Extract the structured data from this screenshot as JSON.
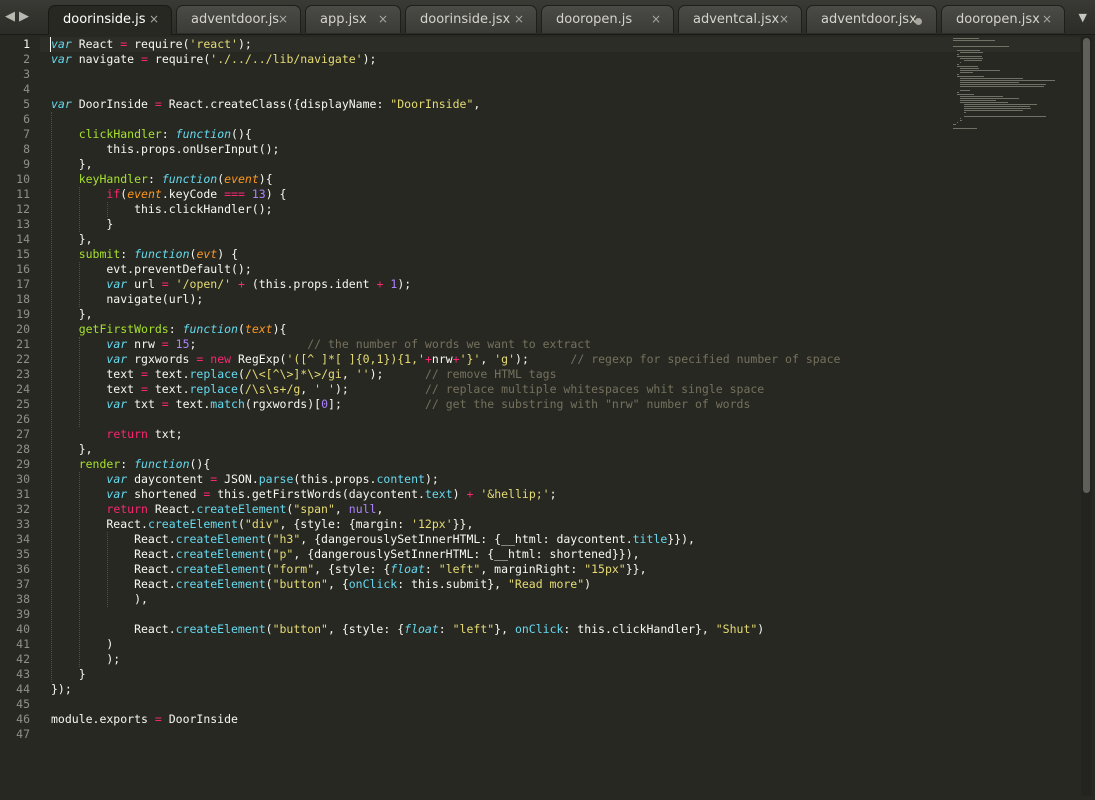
{
  "tabs": [
    {
      "label": "doorinside.js",
      "active": true,
      "dirty": false
    },
    {
      "label": "adventdoor.js",
      "active": false,
      "dirty": false
    },
    {
      "label": "app.jsx",
      "active": false,
      "dirty": false
    },
    {
      "label": "doorinside.jsx",
      "active": false,
      "dirty": false
    },
    {
      "label": "dooropen.js",
      "active": false,
      "dirty": false
    },
    {
      "label": "adventcal.jsx",
      "active": false,
      "dirty": false
    },
    {
      "label": "adventdoor.jsx",
      "active": false,
      "dirty": true
    },
    {
      "label": "dooropen.jsx",
      "active": false,
      "dirty": false
    }
  ],
  "tab_close_glyph": "×",
  "nav": {
    "prev_glyph": "◀",
    "next_glyph": "▶",
    "dropdown_glyph": "▼"
  },
  "editor": {
    "active_line": 1,
    "lines": [
      [
        [
          "k",
          "var"
        ],
        [
          "t",
          " React "
        ],
        [
          "kw",
          "="
        ],
        [
          "t",
          " require("
        ],
        [
          "s",
          "'react'"
        ],
        [
          "t",
          ");"
        ]
      ],
      [
        [
          "k",
          "var"
        ],
        [
          "t",
          " navigate "
        ],
        [
          "kw",
          "="
        ],
        [
          "t",
          " require("
        ],
        [
          "s",
          "'./../../lib/navigate'"
        ],
        [
          "t",
          ");"
        ]
      ],
      [],
      [],
      [
        [
          "k",
          "var"
        ],
        [
          "t",
          " DoorInside "
        ],
        [
          "kw",
          "="
        ],
        [
          "t",
          " React.createClass({displayName: "
        ],
        [
          "s",
          "\"DoorInside\""
        ],
        [
          "t",
          ","
        ]
      ],
      [],
      [
        [
          "t",
          "    "
        ],
        [
          "f",
          "clickHandler"
        ],
        [
          "t",
          ": "
        ],
        [
          "k",
          "function"
        ],
        [
          "t",
          "(){"
        ]
      ],
      [
        [
          "t",
          "        this.props.onUserInput();"
        ]
      ],
      [
        [
          "t",
          "    },"
        ]
      ],
      [
        [
          "t",
          "    "
        ],
        [
          "f",
          "keyHandler"
        ],
        [
          "t",
          ": "
        ],
        [
          "k",
          "function"
        ],
        [
          "t",
          "("
        ],
        [
          "p",
          "event"
        ],
        [
          "t",
          "){"
        ]
      ],
      [
        [
          "t",
          "        "
        ],
        [
          "kw",
          "if"
        ],
        [
          "t",
          "("
        ],
        [
          "p",
          "event"
        ],
        [
          "t",
          ".keyCode "
        ],
        [
          "kw",
          "==="
        ],
        [
          "t",
          " "
        ],
        [
          "n",
          "13"
        ],
        [
          "t",
          ") {"
        ]
      ],
      [
        [
          "t",
          "            this.clickHandler();"
        ]
      ],
      [
        [
          "t",
          "        }"
        ]
      ],
      [
        [
          "t",
          "    },"
        ]
      ],
      [
        [
          "t",
          "    "
        ],
        [
          "f",
          "submit"
        ],
        [
          "t",
          ": "
        ],
        [
          "k",
          "function"
        ],
        [
          "t",
          "("
        ],
        [
          "p",
          "evt"
        ],
        [
          "t",
          ") {"
        ]
      ],
      [
        [
          "t",
          "        evt.preventDefault();"
        ]
      ],
      [
        [
          "t",
          "        "
        ],
        [
          "k",
          "var"
        ],
        [
          "t",
          " url "
        ],
        [
          "kw",
          "="
        ],
        [
          "t",
          " "
        ],
        [
          "s",
          "'/open/'"
        ],
        [
          "t",
          " "
        ],
        [
          "kw",
          "+"
        ],
        [
          "t",
          " (this.props.ident "
        ],
        [
          "kw",
          "+"
        ],
        [
          "t",
          " "
        ],
        [
          "n",
          "1"
        ],
        [
          "t",
          ");"
        ]
      ],
      [
        [
          "t",
          "        navigate(url);"
        ]
      ],
      [
        [
          "t",
          "    },"
        ]
      ],
      [
        [
          "t",
          "    "
        ],
        [
          "f",
          "getFirstWords"
        ],
        [
          "t",
          ": "
        ],
        [
          "k",
          "function"
        ],
        [
          "t",
          "("
        ],
        [
          "p",
          "text"
        ],
        [
          "t",
          "){"
        ]
      ],
      [
        [
          "t",
          "        "
        ],
        [
          "k",
          "var"
        ],
        [
          "t",
          " nrw "
        ],
        [
          "kw",
          "="
        ],
        [
          "t",
          " "
        ],
        [
          "n",
          "15"
        ],
        [
          "t",
          ";                "
        ],
        [
          "c",
          "// the number of words we want to extract"
        ]
      ],
      [
        [
          "t",
          "        "
        ],
        [
          "k",
          "var"
        ],
        [
          "t",
          " rgxwords "
        ],
        [
          "kw",
          "="
        ],
        [
          "t",
          " "
        ],
        [
          "kw",
          "new"
        ],
        [
          "t",
          " RegExp("
        ],
        [
          "s",
          "'([^ ]*[ ]{0,1}){1,'"
        ],
        [
          "kw",
          "+"
        ],
        [
          "t",
          "nrw"
        ],
        [
          "kw",
          "+"
        ],
        [
          "s",
          "'}'"
        ],
        [
          "t",
          ", "
        ],
        [
          "s",
          "'g'"
        ],
        [
          "t",
          ");      "
        ],
        [
          "c",
          "// regexp for specified number of space"
        ]
      ],
      [
        [
          "t",
          "        text "
        ],
        [
          "kw",
          "="
        ],
        [
          "t",
          " text."
        ],
        [
          "sp",
          "replace"
        ],
        [
          "t",
          "("
        ],
        [
          "s",
          "/\\<[^\\>]*\\>/gi"
        ],
        [
          "t",
          ", "
        ],
        [
          "s",
          "''"
        ],
        [
          "t",
          ");      "
        ],
        [
          "c",
          "// remove HTML tags"
        ]
      ],
      [
        [
          "t",
          "        text "
        ],
        [
          "kw",
          "="
        ],
        [
          "t",
          " text."
        ],
        [
          "sp",
          "replace"
        ],
        [
          "t",
          "("
        ],
        [
          "s",
          "/\\s\\s+/g"
        ],
        [
          "t",
          ", "
        ],
        [
          "s",
          "' '"
        ],
        [
          "t",
          ");           "
        ],
        [
          "c",
          "// replace multiple whitespaces whit single space"
        ]
      ],
      [
        [
          "t",
          "        "
        ],
        [
          "k",
          "var"
        ],
        [
          "t",
          " txt "
        ],
        [
          "kw",
          "="
        ],
        [
          "t",
          " text."
        ],
        [
          "sp",
          "match"
        ],
        [
          "t",
          "(rgxwords)["
        ],
        [
          "n",
          "0"
        ],
        [
          "t",
          "];            "
        ],
        [
          "c",
          "// get the substring with \"nrw\" number of words"
        ]
      ],
      [],
      [
        [
          "t",
          "        "
        ],
        [
          "kw",
          "return"
        ],
        [
          "t",
          " txt;"
        ]
      ],
      [
        [
          "t",
          "    },"
        ]
      ],
      [
        [
          "t",
          "    "
        ],
        [
          "f",
          "render"
        ],
        [
          "t",
          ": "
        ],
        [
          "k",
          "function"
        ],
        [
          "t",
          "(){"
        ]
      ],
      [
        [
          "t",
          "        "
        ],
        [
          "k",
          "var"
        ],
        [
          "t",
          " daycontent "
        ],
        [
          "kw",
          "="
        ],
        [
          "t",
          " JSON."
        ],
        [
          "sp",
          "parse"
        ],
        [
          "t",
          "(this.props."
        ],
        [
          "sp",
          "content"
        ],
        [
          "t",
          ");"
        ]
      ],
      [
        [
          "t",
          "        "
        ],
        [
          "k",
          "var"
        ],
        [
          "t",
          " shortened "
        ],
        [
          "kw",
          "="
        ],
        [
          "t",
          " this.getFirstWords(daycontent."
        ],
        [
          "sp",
          "text"
        ],
        [
          "t",
          ") "
        ],
        [
          "kw",
          "+"
        ],
        [
          "t",
          " "
        ],
        [
          "s",
          "'&hellip;'"
        ],
        [
          "t",
          ";"
        ]
      ],
      [
        [
          "t",
          "        "
        ],
        [
          "kw",
          "return"
        ],
        [
          "t",
          " React."
        ],
        [
          "sp",
          "createElement"
        ],
        [
          "t",
          "("
        ],
        [
          "s",
          "\"span\""
        ],
        [
          "t",
          ", "
        ],
        [
          "n",
          "null"
        ],
        [
          "t",
          ","
        ]
      ],
      [
        [
          "t",
          "        React."
        ],
        [
          "sp",
          "createElement"
        ],
        [
          "t",
          "("
        ],
        [
          "s",
          "\"div\""
        ],
        [
          "t",
          ", {style: {margin: "
        ],
        [
          "s",
          "'12px'"
        ],
        [
          "t",
          "}},"
        ]
      ],
      [
        [
          "t",
          "            React."
        ],
        [
          "sp",
          "createElement"
        ],
        [
          "t",
          "("
        ],
        [
          "s",
          "\"h3\""
        ],
        [
          "t",
          ", {dangerouslySetInnerHTML: {__html: daycontent."
        ],
        [
          "sp",
          "title"
        ],
        [
          "t",
          "}}),"
        ]
      ],
      [
        [
          "t",
          "            React."
        ],
        [
          "sp",
          "createElement"
        ],
        [
          "t",
          "("
        ],
        [
          "s",
          "\"p\""
        ],
        [
          "t",
          ", {dangerouslySetInnerHTML: {__html: shortened}}),"
        ]
      ],
      [
        [
          "t",
          "            React."
        ],
        [
          "sp",
          "createElement"
        ],
        [
          "t",
          "("
        ],
        [
          "s",
          "\"form\""
        ],
        [
          "t",
          ", {style: {"
        ],
        [
          "k",
          "float"
        ],
        [
          "t",
          ": "
        ],
        [
          "s",
          "\"left\""
        ],
        [
          "t",
          ", marginRight: "
        ],
        [
          "s",
          "\"15px\""
        ],
        [
          "t",
          "}},"
        ]
      ],
      [
        [
          "t",
          "            React."
        ],
        [
          "sp",
          "createElement"
        ],
        [
          "t",
          "("
        ],
        [
          "s",
          "\"button\""
        ],
        [
          "t",
          ", {"
        ],
        [
          "sp",
          "onClick"
        ],
        [
          "t",
          ": this.submit}, "
        ],
        [
          "s",
          "\"Read more\""
        ],
        [
          "t",
          ")"
        ]
      ],
      [
        [
          "t",
          "            ),"
        ]
      ],
      [],
      [
        [
          "t",
          "            React."
        ],
        [
          "sp",
          "createElement"
        ],
        [
          "t",
          "("
        ],
        [
          "s",
          "\"button\""
        ],
        [
          "t",
          ", {style: {"
        ],
        [
          "k",
          "float"
        ],
        [
          "t",
          ": "
        ],
        [
          "s",
          "\"left\""
        ],
        [
          "t",
          "}, "
        ],
        [
          "sp",
          "onClick"
        ],
        [
          "t",
          ": this.clickHandler}, "
        ],
        [
          "s",
          "\"Shut\""
        ],
        [
          "t",
          ")"
        ]
      ],
      [
        [
          "t",
          "        )"
        ]
      ],
      [
        [
          "t",
          "        );"
        ]
      ],
      [
        [
          "t",
          "    }"
        ]
      ],
      [
        [
          "t",
          "});"
        ]
      ],
      [],
      [
        [
          "t",
          "module.exports "
        ],
        [
          "kw",
          "="
        ],
        [
          "t",
          " DoorInside"
        ]
      ],
      []
    ]
  },
  "colors": {
    "background": "#272822",
    "keyword": "#f92672",
    "storage": "#66d9ef",
    "string": "#e6db74",
    "number": "#ae81ff",
    "function_name": "#a6e22e",
    "parameter": "#fd971f",
    "comment": "#75715e"
  }
}
